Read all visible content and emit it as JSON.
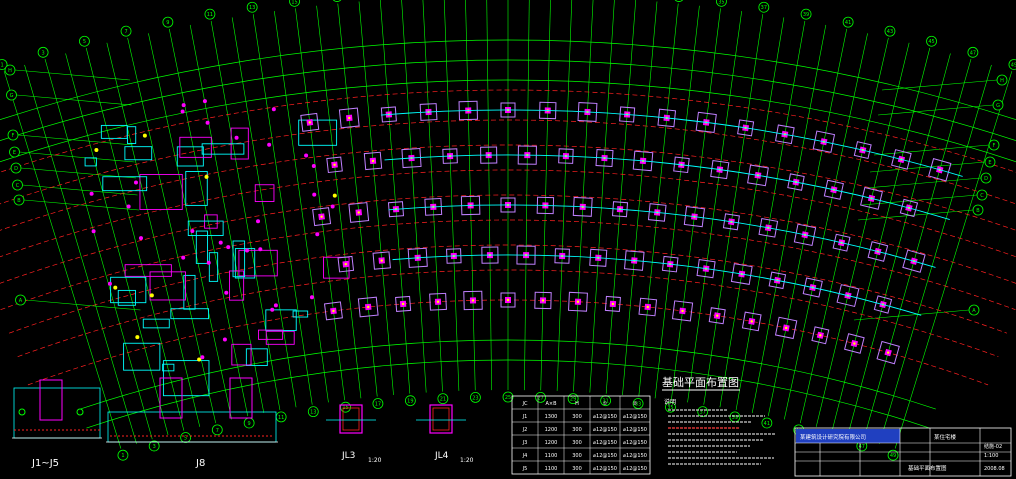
{
  "drawing": {
    "plan_title": "基础平面布置图",
    "colors": {
      "background": "#000000",
      "axis": "#00ff00",
      "dim": "#00ff00",
      "wall": "#00ffff",
      "column": "#ff00ff",
      "pad": "#c080ff",
      "arc": "#ff2020",
      "note": "#ffffff",
      "title_fill": "#2040c0",
      "yellow": "#ffff00"
    },
    "top_axis_labels": [
      "1",
      "2",
      "3",
      "4",
      "5",
      "6",
      "7",
      "8",
      "9",
      "10",
      "11",
      "12",
      "13",
      "14",
      "15",
      "16",
      "17",
      "18",
      "19",
      "20",
      "21",
      "22",
      "23",
      "24",
      "25",
      "26",
      "27",
      "28",
      "29",
      "30",
      "31",
      "32",
      "33",
      "34",
      "35",
      "36",
      "37",
      "38",
      "39",
      "40",
      "41",
      "42",
      "43",
      "44",
      "45",
      "46",
      "47",
      "48",
      "49"
    ],
    "left_axis_labels": [
      "H",
      "G",
      "F",
      "E",
      "D",
      "C",
      "B",
      "A"
    ],
    "right_axis_labels": [
      "H",
      "G",
      "F",
      "E",
      "D",
      "C",
      "B",
      "A"
    ],
    "details": [
      {
        "label": "J1~J5"
      },
      {
        "label": "J8"
      },
      {
        "label": "JL3",
        "scale": "1:20"
      },
      {
        "label": "JL4",
        "scale": "1:20"
      }
    ],
    "footing_table": {
      "headers": [
        "JC",
        "A×B",
        "H",
        "①",
        "②"
      ],
      "rows": [
        [
          "J1",
          "1300",
          "300",
          "⌀12@150",
          "⌀12@150"
        ],
        [
          "J2",
          "1200",
          "300",
          "⌀12@150",
          "⌀12@150"
        ],
        [
          "J3",
          "1200",
          "300",
          "⌀12@150",
          "⌀12@150"
        ],
        [
          "J4",
          "1100",
          "300",
          "⌀12@150",
          "⌀12@150"
        ],
        [
          "J5",
          "1100",
          "300",
          "⌀12@150",
          "⌀12@150"
        ]
      ]
    },
    "notes_title": "说明",
    "title_block": {
      "company": "某建筑设计研究院有限公司",
      "project": "某住宅楼",
      "drawing_name": "基础平面布置图",
      "sheet": "结施-02",
      "scale": "1:100",
      "date": "2008.08"
    }
  }
}
